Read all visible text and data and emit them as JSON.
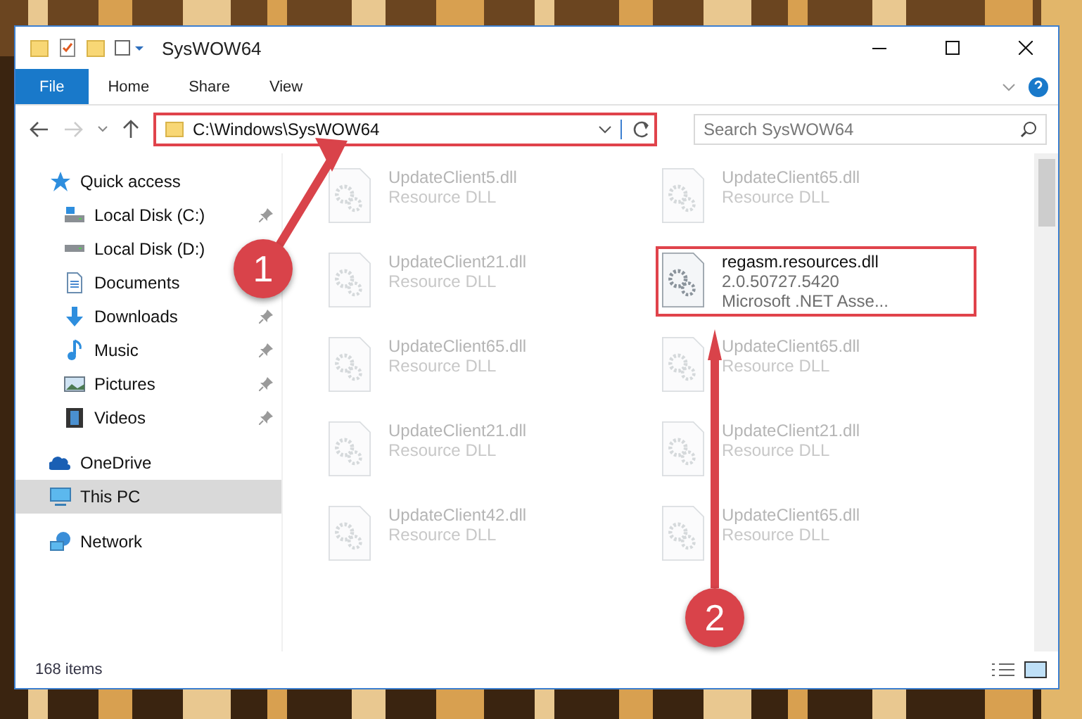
{
  "window": {
    "title": "SysWOW64"
  },
  "ribbon_tabs": [
    {
      "label": "File",
      "kind": "file"
    },
    {
      "label": "Home",
      "kind": "tab"
    },
    {
      "label": "Share",
      "kind": "tab"
    },
    {
      "label": "View",
      "kind": "tab"
    }
  ],
  "address_bar": {
    "path": "C:\\Windows\\SysWOW64",
    "highlighted": true
  },
  "search": {
    "placeholder": "Search SysWOW64"
  },
  "sidebar": {
    "items": [
      {
        "label": "Quick access",
        "kind": "star",
        "selected": false,
        "pinned": false,
        "children": [
          {
            "label": "Local Disk (C:)",
            "kind": "disk-c",
            "selected": false,
            "pinned": true
          },
          {
            "label": "Local Disk (D:)",
            "kind": "disk",
            "selected": false
          },
          {
            "label": "Documents",
            "kind": "documents",
            "selected": false
          },
          {
            "label": "Downloads",
            "kind": "downloads",
            "selected": false,
            "pinned": true
          },
          {
            "label": "Music",
            "kind": "music",
            "selected": false,
            "pinned": true
          },
          {
            "label": "Pictures",
            "kind": "pictures",
            "selected": false,
            "pinned": true
          },
          {
            "label": "Videos",
            "kind": "videos",
            "selected": false,
            "pinned": true
          }
        ]
      },
      {
        "label": "OneDrive",
        "kind": "cloud",
        "selected": false,
        "pinned": false
      },
      {
        "label": "This PC",
        "kind": "pc",
        "selected": true,
        "pinned": false
      },
      {
        "label": "Network",
        "kind": "network",
        "selected": false,
        "pinned": false
      }
    ]
  },
  "files": [
    {
      "name": "UpdateClient5.dll",
      "line_2": "Resource DLL",
      "blurred": true,
      "highlighted": false
    },
    {
      "name": "UpdateClient65.dll",
      "line_2": "Resource DLL",
      "blurred": true,
      "highlighted": false
    },
    {
      "name": "UpdateClient21.dll",
      "line_2": "Resource DLL",
      "blurred": true,
      "highlighted": false
    },
    {
      "name": "regasm.resources.dll",
      "line_2": "2.0.50727.5420",
      "line_3": "Microsoft .NET Asse...",
      "blurred": false,
      "highlighted": true
    },
    {
      "name": "UpdateClient65.dll",
      "line_2": "Resource DLL",
      "blurred": true,
      "highlighted": false
    },
    {
      "name": "UpdateClient65.dll",
      "line_2": "Resource DLL",
      "blurred": true,
      "highlighted": false
    },
    {
      "name": "UpdateClient21.dll",
      "line_2": "Resource DLL",
      "blurred": true,
      "highlighted": false
    },
    {
      "name": "UpdateClient21.dll",
      "line_2": "Resource DLL",
      "blurred": true,
      "highlighted": false
    },
    {
      "name": "UpdateClient42.dll",
      "line_2": "Resource DLL",
      "blurred": true,
      "highlighted": false
    },
    {
      "name": "UpdateClient65.dll",
      "line_2": "Resource DLL",
      "blurred": true,
      "highlighted": false
    }
  ],
  "status_bar": {
    "item_count": "168 items"
  },
  "annotations": [
    {
      "label": "1"
    },
    {
      "label": "2"
    }
  ]
}
